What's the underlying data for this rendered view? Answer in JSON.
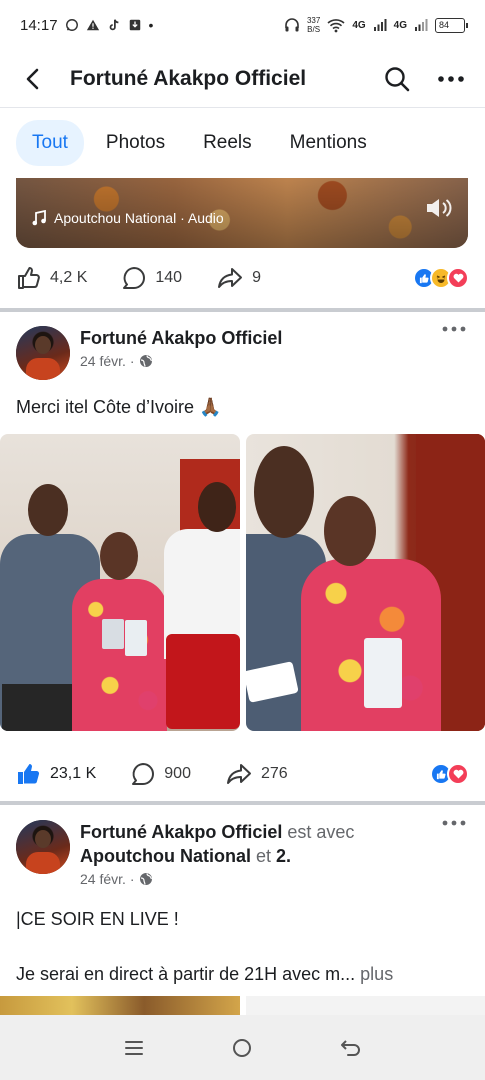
{
  "status_bar": {
    "time": "14:17",
    "net_speed_value": "337",
    "net_speed_unit": "B/S",
    "signal1": "4G",
    "signal2": "4G",
    "battery": "84"
  },
  "header": {
    "title": "Fortuné Akakpo Officiel",
    "back_icon": "arrow-left-icon",
    "search_icon": "search-icon",
    "more_icon": "more-horizontal-icon"
  },
  "tabs": [
    {
      "label": "Tout",
      "active": true
    },
    {
      "label": "Photos",
      "active": false
    },
    {
      "label": "Reels",
      "active": false
    },
    {
      "label": "Mentions",
      "active": false
    }
  ],
  "prev_post": {
    "audio_label": "Apoutchou National · Audio",
    "reactions": {
      "likes": "4,2 K",
      "comments": "140",
      "shares": "9"
    }
  },
  "post1": {
    "author": "Fortuné Akakpo Officiel",
    "date": "24 févr.",
    "privacy_icon": "globe-icon",
    "text": "Merci itel Côte d’Ivoire 🙏🏾",
    "reactions": {
      "likes": "23,1 K",
      "comments": "900",
      "shares": "276"
    }
  },
  "post2": {
    "author": "Fortuné Akakpo Officiel",
    "with_text": "est avec",
    "tagged": "Apoutchou National",
    "and_text": "et",
    "others": "2",
    "period": ".",
    "date": "24 févr.",
    "text_line1": "|CE SOIR EN LIVE !",
    "text_line2": "Je serai en direct à partir de 21H avec m...",
    "see_more": "plus"
  },
  "colors": {
    "accent": "#1877f2",
    "tab_active_bg": "#e7f3ff",
    "love": "#f33e58",
    "haha": "#f7b928"
  }
}
